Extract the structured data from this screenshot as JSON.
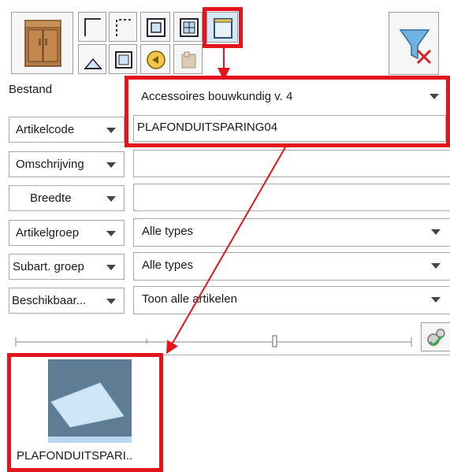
{
  "toolbar": {
    "icons": [
      "cabinet-icon",
      "corner-profile-icon",
      "dotted-corner-icon",
      "window-frame-icon",
      "grid-window-icon",
      "ceiling-opening-icon",
      "roof-icon",
      "square-frame-icon",
      "speaker-icon",
      "accessory-box-icon"
    ],
    "filter_icon": "filter-clear-icon"
  },
  "form": {
    "bestand_label": "Bestand",
    "bestand_value": "Accessoires bouwkundig v. 4",
    "artikelcode_label": "Artikelcode",
    "artikelcode_value": "PLAFONDUITSPARING04",
    "omschrijving_label": "Omschrijving",
    "omschrijving_value": "",
    "breedte_label": "Breedte",
    "breedte_value": "",
    "artikelgroep_label": "Artikelgroep",
    "artikelgroep_value": "Alle types",
    "subart_label": "Subart. groep",
    "subart_value": "Alle types",
    "beschikbaar_label": "Beschikbaar...",
    "beschikbaar_value": "Toon alle artikelen"
  },
  "results": {
    "items": [
      {
        "label": "PLAFONDUITSPARI.."
      }
    ]
  },
  "colors": {
    "highlight": "#e3141b",
    "thumbnail_bg": "#5e7d94"
  }
}
